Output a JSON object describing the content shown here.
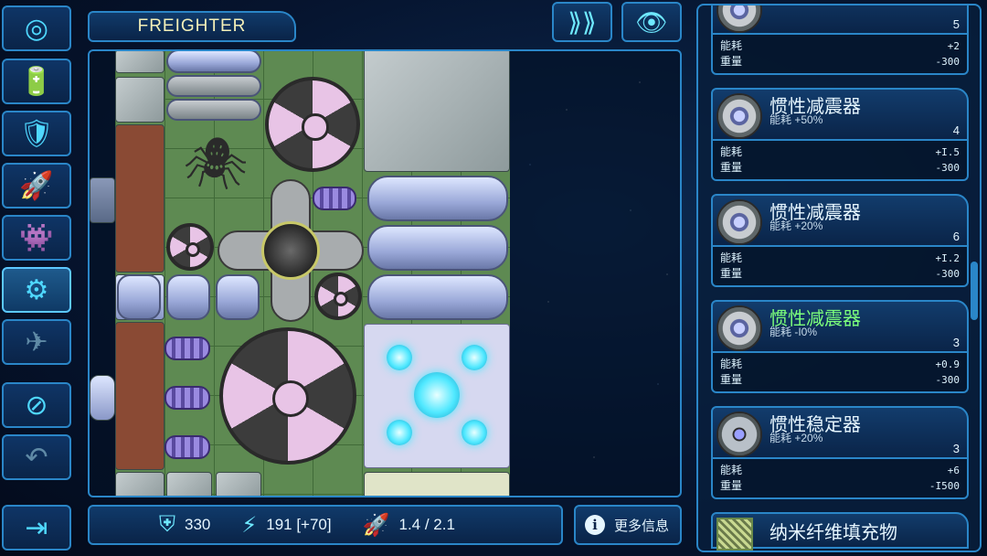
{
  "header": {
    "ship_name": "FREIGHTER"
  },
  "toolbar": {
    "items": [
      {
        "name": "weapons-tool",
        "icon": "target-icon",
        "glyph": "◎"
      },
      {
        "name": "power-tool",
        "icon": "battery-icon",
        "glyph": "🔋"
      },
      {
        "name": "shield-tool",
        "icon": "shield-icon",
        "glyph": "🛡"
      },
      {
        "name": "thruster-tool",
        "icon": "rocket-icon",
        "glyph": "🚀"
      },
      {
        "name": "crew-tool",
        "icon": "alien-icon",
        "glyph": "👾"
      },
      {
        "name": "system-tool",
        "icon": "gear-icon",
        "glyph": "⚙"
      },
      {
        "name": "ship-tool",
        "icon": "ship-icon",
        "glyph": "✈"
      },
      {
        "name": "delete-tool",
        "icon": "prohibit-icon",
        "glyph": "⊘"
      },
      {
        "name": "undo-tool",
        "icon": "undo-icon",
        "glyph": "↶"
      },
      {
        "name": "exit-tool",
        "icon": "exit-icon",
        "glyph": "⇥"
      }
    ]
  },
  "stats": {
    "armor": "330",
    "power": "191 [+70]",
    "thrust": "1.4 / 2.1"
  },
  "more_info_label": "更多信息",
  "components": [
    {
      "name": "",
      "sub": "",
      "count": "5",
      "energy_label": "能耗",
      "energy": "+2",
      "weight_label": "重量",
      "weight": "-300",
      "highlight": false
    },
    {
      "name": "惯性减震器",
      "sub": "能耗 +50%",
      "count": "4",
      "energy_label": "能耗",
      "energy": "+I.5",
      "weight_label": "重量",
      "weight": "-300",
      "highlight": false
    },
    {
      "name": "惯性减震器",
      "sub": "能耗 +20%",
      "count": "6",
      "energy_label": "能耗",
      "energy": "+I.2",
      "weight_label": "重量",
      "weight": "-300",
      "highlight": false
    },
    {
      "name": "惯性减震器",
      "sub": "能耗 -I0%",
      "count": "3",
      "energy_label": "能耗",
      "energy": "+0.9",
      "weight_label": "重量",
      "weight": "-300",
      "highlight": true
    },
    {
      "name": "惯性稳定器",
      "sub": "能耗 +20%",
      "count": "3",
      "energy_label": "能耗",
      "energy": "+6",
      "weight_label": "重量",
      "weight": "-I500",
      "highlight": false
    }
  ],
  "partial_component": {
    "name": "纳米纤维填充物"
  },
  "colors": {
    "accent": "#2a86c8",
    "highlight": "#7cff7c",
    "glow": "#4fe8ff"
  }
}
